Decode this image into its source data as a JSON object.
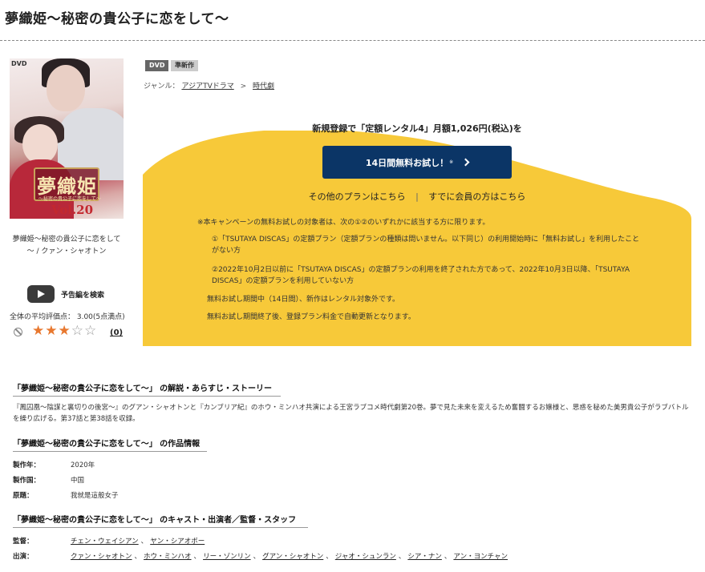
{
  "page": {
    "title": "夢織姫～秘密の貴公子に恋をして～"
  },
  "cover": {
    "dvd_tag": "DVD",
    "logo_text": "夢織姫",
    "logo_sub": "～秘密の貴公子に恋をして～",
    "volume": "Vol.20",
    "caption": "夢織姫～秘密の貴公子に恋をして～ / クァン・シャオトン"
  },
  "trailer": {
    "label": "予告編を検索"
  },
  "rating": {
    "average_text": "全体の平均評価点： 3.00(5点満点)",
    "score": 3,
    "max": 5,
    "review_count": "(0)"
  },
  "badges": {
    "dvd": "DVD",
    "new_release": "準新作"
  },
  "genre": {
    "label": "ジャンル：",
    "items": [
      "アジアTVドラマ",
      "時代劇"
    ],
    "separator": ">"
  },
  "campaign": {
    "lead": "新規登録で「定額レンタル4」月額1,026円(税込)を",
    "trial_button": "14日間無料お試し！",
    "trial_note": "※",
    "other_plans": "その他のプランはこちら",
    "members": "すでに会員の方はこちら",
    "note_main": "※本キャンペーンの無料お試しの対象者は、次の①②のいずれかに該当する方に限ります。",
    "note_1": "①「TSUTAYA DISCAS」の定額プラン（定額プランの種類は問いません。以下同じ）の利用開始時に「無料お試し」を利用したことがない方",
    "note_2": "②2022年10月2日以前に「TSUTAYA DISCAS」の定額プランの利用を終了された方であって、2022年10月3日以降、「TSUTAYA DISCAS」の定額プランを利用していない方",
    "note_3": "無料お試し期間中（14日間）、新作はレンタル対象外です。",
    "note_4": "無料お試し期間終了後、登録プラン料金で自動更新となります。"
  },
  "story": {
    "heading": "「夢織姫～秘密の貴公子に恋をして～」 の解説・あらすじ・ストーリー",
    "text": "『鳳囚凰～陰謀と裏切りの後宮～』のグアン・シャオトンと『カンブリア紀』のホウ・ミンハオ共演による王宮ラブコメ時代劇第20巻。夢で見た未来を変えるため奮闘するお嬢様と、思惑を秘めた美男貴公子がラブバトルを繰り広げる。第37話と第38話を収録。"
  },
  "info": {
    "heading": "「夢織姫～秘密の貴公子に恋をして～」 の作品情報",
    "year_label": "製作年：",
    "year": "2020年",
    "country_label": "製作国：",
    "country": "中国",
    "original_label": "原題：",
    "original": "我就是這般女子"
  },
  "cast": {
    "heading": "「夢織姫～秘密の貴公子に恋をして～」 のキャスト・出演者／監督・スタッフ",
    "director_label": "監督：",
    "directors": [
      "チェン・ウェイシアン",
      "ヤン・シアオボー"
    ],
    "cast_label": "出演：",
    "actors": [
      "クァン・シャオトン",
      "ホウ・ミンハオ",
      "リー・ゾンリン",
      "グアン・シャオトン",
      "ジャオ・シュンラン",
      "シア・ナン",
      "アン・ヨンチャン"
    ],
    "separator": "、"
  },
  "colors": {
    "accent_yellow": "#f7c939",
    "button_navy": "#0b3566",
    "star_orange": "#e8782f"
  }
}
